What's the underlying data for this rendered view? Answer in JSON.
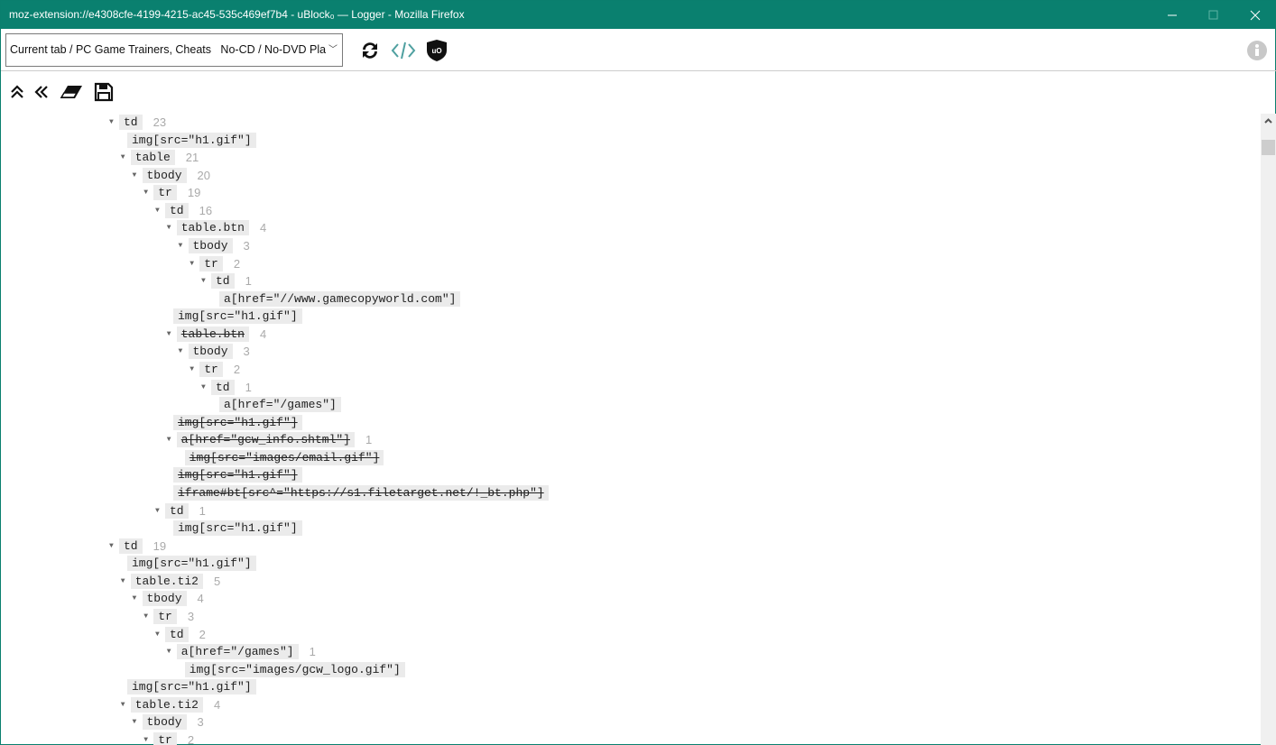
{
  "window": {
    "title": "moz-extension://e4308cfe-4199-4215-ac45-535c469ef7b4 - uBlock₀ — Logger - Mozilla Firefox"
  },
  "toolbar": {
    "tab_select": "Current tab / PC Game Trainers, Cheats   No-CD / No-DVD Pla"
  },
  "tree": [
    {
      "d": 0,
      "t": "td",
      "c": "23"
    },
    {
      "d": 1,
      "t": "img[src=\"h1.gif\"]",
      "leaf": true
    },
    {
      "d": 1,
      "t": "table",
      "c": "21"
    },
    {
      "d": 2,
      "t": "tbody",
      "c": "20"
    },
    {
      "d": 3,
      "t": "tr",
      "c": "19"
    },
    {
      "d": 4,
      "t": "td",
      "c": "16"
    },
    {
      "d": 5,
      "t": "table.btn",
      "c": "4"
    },
    {
      "d": 6,
      "t": "tbody",
      "c": "3"
    },
    {
      "d": 7,
      "t": "tr",
      "c": "2"
    },
    {
      "d": 8,
      "t": "td",
      "c": "1"
    },
    {
      "d": 9,
      "t": "a[href=\"//www.gamecopyworld.com\"]",
      "leaf": true
    },
    {
      "d": 5,
      "t": "img[src=\"h1.gif\"]",
      "leaf": true
    },
    {
      "d": 5,
      "t": "table.btn",
      "c": "4",
      "s": true
    },
    {
      "d": 6,
      "t": "tbody",
      "c": "3"
    },
    {
      "d": 7,
      "t": "tr",
      "c": "2"
    },
    {
      "d": 8,
      "t": "td",
      "c": "1"
    },
    {
      "d": 9,
      "t": "a[href=\"/games\"]",
      "leaf": true
    },
    {
      "d": 5,
      "t": "img[src=\"h1.gif\"]",
      "leaf": true,
      "s": true
    },
    {
      "d": 5,
      "t": "a[href=\"gcw_info.shtml\"]",
      "c": "1",
      "s": true
    },
    {
      "d": 6,
      "t": "img[src=\"images/email.gif\"]",
      "leaf": true,
      "s": true
    },
    {
      "d": 5,
      "t": "img[src=\"h1.gif\"]",
      "leaf": true,
      "s": true
    },
    {
      "d": 5,
      "t": "iframe#bt[src^=\"https://s1.filetarget.net/!_bt.php\"]",
      "leaf": true,
      "s": true
    },
    {
      "d": 4,
      "t": "td",
      "c": "1"
    },
    {
      "d": 5,
      "t": "img[src=\"h1.gif\"]",
      "leaf": true
    },
    {
      "d": 0,
      "t": "td",
      "c": "19"
    },
    {
      "d": 1,
      "t": "img[src=\"h1.gif\"]",
      "leaf": true
    },
    {
      "d": 1,
      "t": "table.ti2",
      "c": "5"
    },
    {
      "d": 2,
      "t": "tbody",
      "c": "4"
    },
    {
      "d": 3,
      "t": "tr",
      "c": "3"
    },
    {
      "d": 4,
      "t": "td",
      "c": "2"
    },
    {
      "d": 5,
      "t": "a[href=\"/games\"]",
      "c": "1"
    },
    {
      "d": 6,
      "t": "img[src=\"images/gcw_logo.gif\"]",
      "leaf": true
    },
    {
      "d": 1,
      "t": "img[src=\"h1.gif\"]",
      "leaf": true
    },
    {
      "d": 1,
      "t": "table.ti2",
      "c": "4"
    },
    {
      "d": 2,
      "t": "tbody",
      "c": "3"
    },
    {
      "d": 3,
      "t": "tr",
      "c": "2"
    }
  ]
}
